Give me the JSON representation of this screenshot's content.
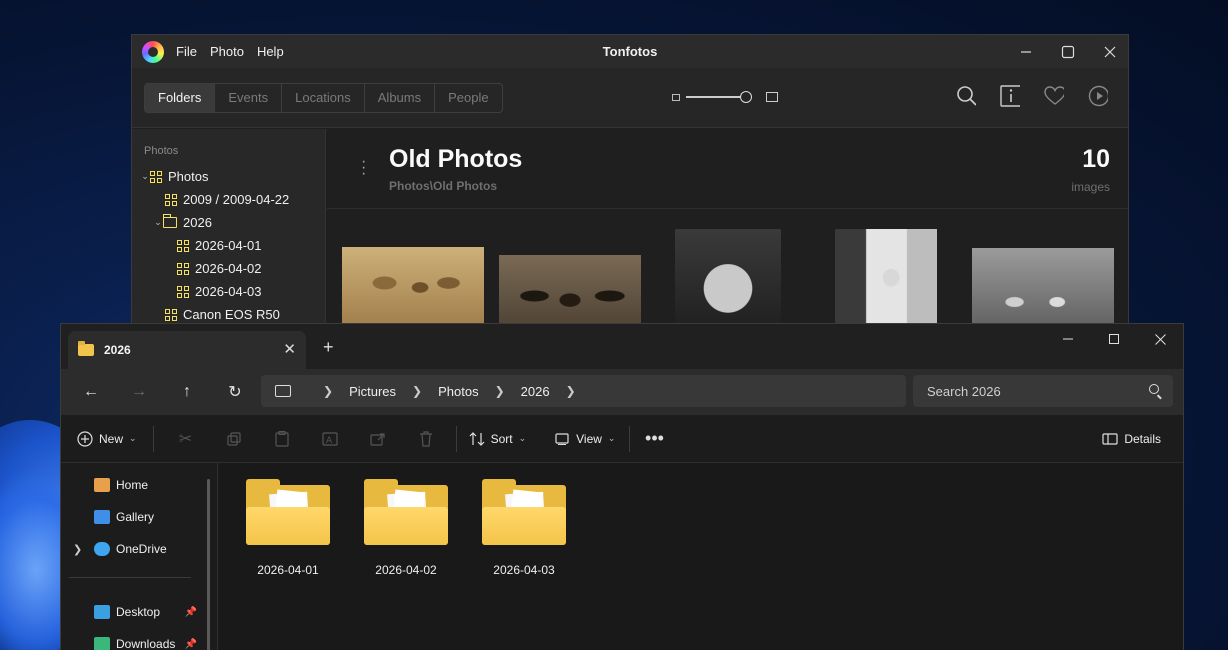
{
  "tonfotos": {
    "title": "Tonfotos",
    "menu": [
      "File",
      "Photo",
      "Help"
    ],
    "tabs": [
      "Folders",
      "Events",
      "Locations",
      "Albums",
      "People"
    ],
    "active_tab": "Folders",
    "sidebar": {
      "heading": "Photos",
      "nodes": [
        {
          "label": "Photos",
          "level": 0,
          "expanded": true,
          "icon": "album-grid-icon"
        },
        {
          "label": "2009 / 2009-04-22",
          "level": 1,
          "icon": "album-grid-icon"
        },
        {
          "label": "2026",
          "level": 1,
          "expanded": true,
          "icon": "folder-icon"
        },
        {
          "label": "2026-04-01",
          "level": 2,
          "icon": "album-grid-icon"
        },
        {
          "label": "2026-04-02",
          "level": 2,
          "icon": "album-grid-icon"
        },
        {
          "label": "2026-04-03",
          "level": 2,
          "icon": "album-grid-icon"
        },
        {
          "label": "Canon EOS R50",
          "level": 1,
          "icon": "album-grid-icon"
        }
      ]
    },
    "main": {
      "title": "Old Photos",
      "path": "Photos\\Old Photos",
      "count": "10",
      "count_label": "images"
    },
    "accent_color": "#f6e05e"
  },
  "explorer": {
    "tab_title": "2026",
    "breadcrumb": [
      "Pictures",
      "Photos",
      "2026"
    ],
    "search_placeholder": "Search 2026",
    "commands": {
      "new": "New",
      "sort": "Sort",
      "view": "View",
      "details": "Details"
    },
    "sidebar": [
      {
        "label": "Home",
        "icon": "home-icon",
        "color": "#e8a04a"
      },
      {
        "label": "Gallery",
        "icon": "gallery-icon",
        "color": "#3f8ee8"
      },
      {
        "label": "OneDrive",
        "icon": "onedrive-cloud-icon",
        "color": "#3ea6f0",
        "expandable": true
      },
      {
        "label": "Desktop",
        "icon": "desktop-icon",
        "color": "#3aa0e0",
        "pinned": true
      },
      {
        "label": "Downloads",
        "icon": "downloads-icon",
        "color": "#3ab87a",
        "pinned": true
      }
    ],
    "folders": [
      "2026-04-01",
      "2026-04-02",
      "2026-04-03"
    ],
    "folder_color": "#f4c44a"
  }
}
